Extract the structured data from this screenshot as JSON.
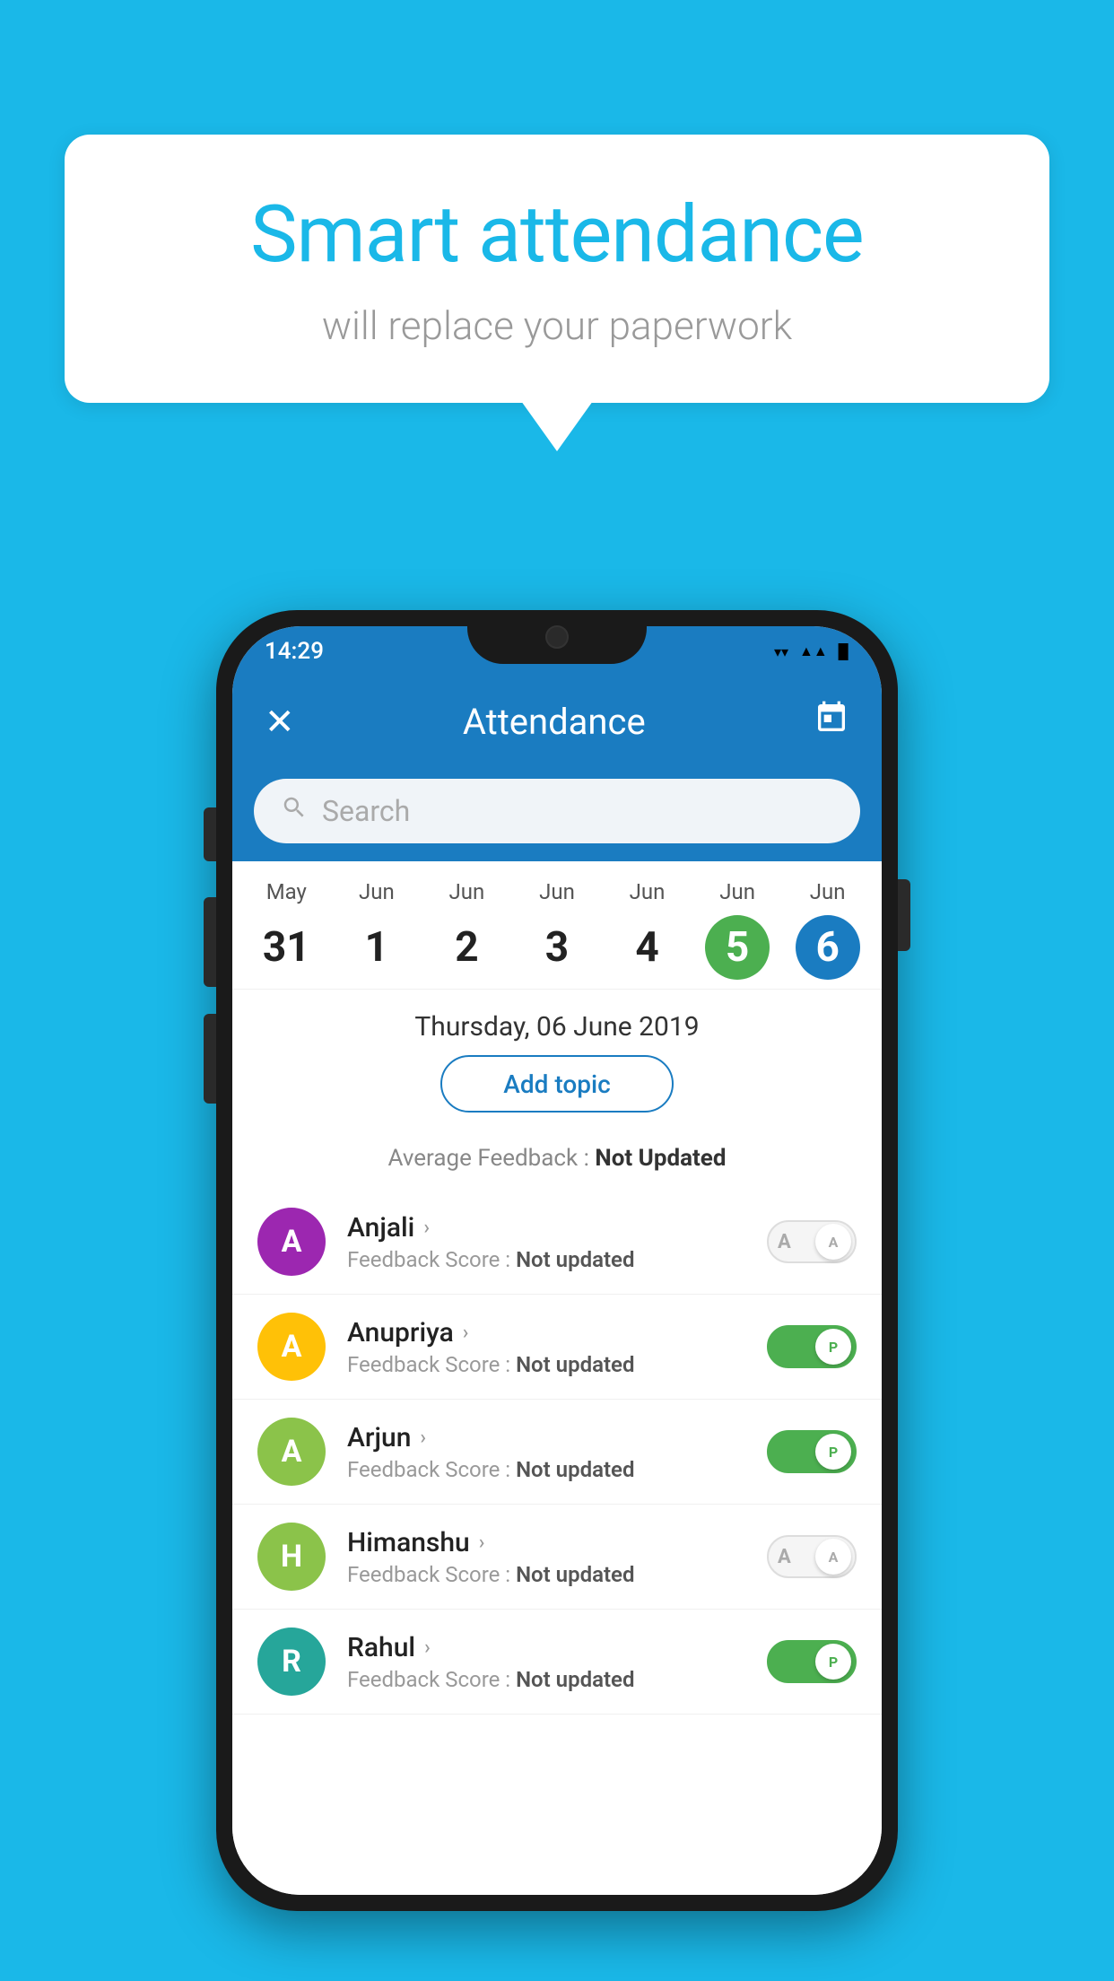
{
  "background_color": "#1ab8e8",
  "speech_bubble": {
    "title": "Smart attendance",
    "subtitle": "will replace your paperwork"
  },
  "status_bar": {
    "time": "14:29",
    "wifi_icon": "▼",
    "signal_icon": "▲",
    "battery_icon": "▉"
  },
  "app_bar": {
    "close_label": "✕",
    "title": "Attendance",
    "calendar_icon": "📅"
  },
  "search": {
    "placeholder": "Search"
  },
  "date_strip": {
    "dates": [
      {
        "month": "May",
        "day": "31",
        "state": "normal"
      },
      {
        "month": "Jun",
        "day": "1",
        "state": "normal"
      },
      {
        "month": "Jun",
        "day": "2",
        "state": "normal"
      },
      {
        "month": "Jun",
        "day": "3",
        "state": "normal"
      },
      {
        "month": "Jun",
        "day": "4",
        "state": "normal"
      },
      {
        "month": "Jun",
        "day": "5",
        "state": "today"
      },
      {
        "month": "Jun",
        "day": "6",
        "state": "selected"
      }
    ]
  },
  "selected_date_label": "Thursday, 06 June 2019",
  "add_topic_button": "Add topic",
  "average_feedback_label": "Average Feedback : ",
  "average_feedback_value": "Not Updated",
  "students": [
    {
      "name": "Anjali",
      "avatar_letter": "A",
      "avatar_color": "#9c27b0",
      "feedback_label": "Feedback Score : ",
      "feedback_value": "Not updated",
      "toggle_state": "off",
      "toggle_letter": "A"
    },
    {
      "name": "Anupriya",
      "avatar_letter": "A",
      "avatar_color": "#FFC107",
      "feedback_label": "Feedback Score : ",
      "feedback_value": "Not updated",
      "toggle_state": "on",
      "toggle_letter": "P"
    },
    {
      "name": "Arjun",
      "avatar_letter": "A",
      "avatar_color": "#8bc34a",
      "feedback_label": "Feedback Score : ",
      "feedback_value": "Not updated",
      "toggle_state": "on",
      "toggle_letter": "P"
    },
    {
      "name": "Himanshu",
      "avatar_letter": "H",
      "avatar_color": "#8bc34a",
      "feedback_label": "Feedback Score : ",
      "feedback_value": "Not updated",
      "toggle_state": "off",
      "toggle_letter": "A"
    },
    {
      "name": "Rahul",
      "avatar_letter": "R",
      "avatar_color": "#26a69a",
      "feedback_label": "Feedback Score : ",
      "feedback_value": "Not updated",
      "toggle_state": "on",
      "toggle_letter": "P"
    }
  ]
}
